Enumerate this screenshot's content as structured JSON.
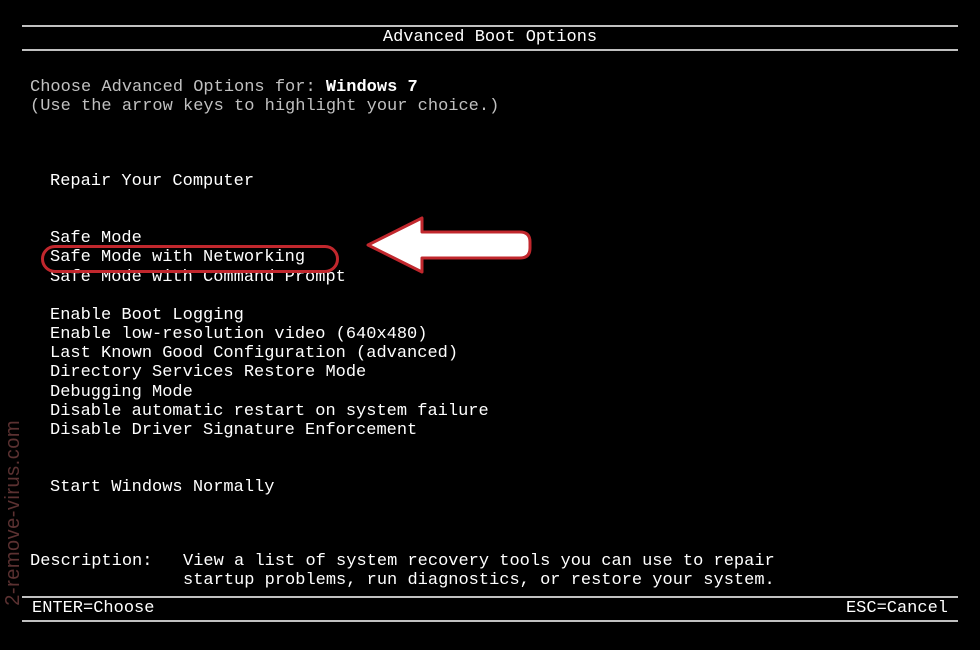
{
  "title": "Advanced Boot Options",
  "prompt": {
    "prefix": "Choose Advanced Options for: ",
    "os": "Windows 7",
    "hint": "(Use the arrow keys to highlight your choice.)"
  },
  "groups": [
    {
      "items": [
        "Repair Your Computer"
      ]
    },
    {
      "items": [
        "Safe Mode",
        "Safe Mode with Networking",
        "Safe Mode with Command Prompt"
      ]
    },
    {
      "items": [
        "Enable Boot Logging",
        "Enable low-resolution video (640x480)",
        "Last Known Good Configuration (advanced)",
        "Directory Services Restore Mode",
        "Debugging Mode",
        "Disable automatic restart on system failure",
        "Disable Driver Signature Enforcement"
      ]
    },
    {
      "items": [
        "Start Windows Normally"
      ]
    }
  ],
  "selected": "Safe Mode with Command Prompt",
  "description": {
    "label": "Description:   ",
    "line1": "View a list of system recovery tools you can use to repair",
    "line2": "               startup problems, run diagnostics, or restore your system."
  },
  "footer": {
    "enter": "ENTER=Choose",
    "esc": "ESC=Cancel"
  },
  "watermark": "2-remove-virus.com"
}
